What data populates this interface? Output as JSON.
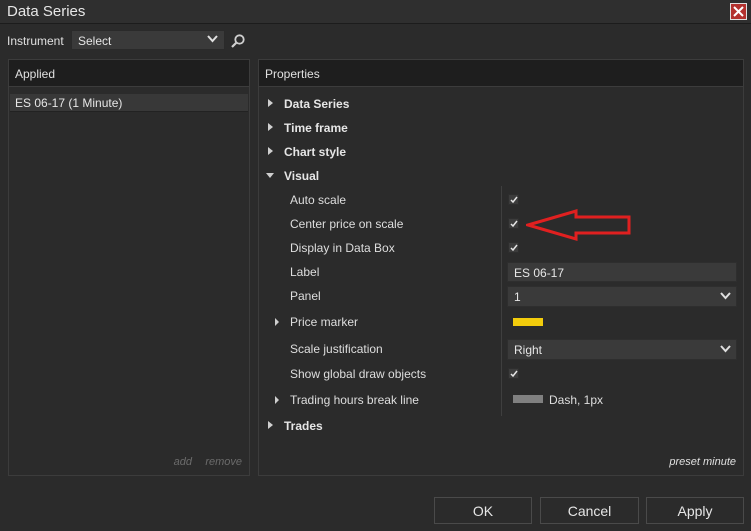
{
  "window": {
    "title": "Data Series"
  },
  "colors": {
    "accent_close": "#b3312e",
    "price_marker": "#f2cc0c",
    "break_line": "#808080",
    "annotation_arrow": "#e02020"
  },
  "instrument": {
    "label": "Instrument",
    "select_value": "Select"
  },
  "applied": {
    "header": "Applied",
    "items": [
      "ES 06-17 (1 Minute)"
    ],
    "add_label": "add",
    "remove_label": "remove"
  },
  "properties": {
    "header": "Properties",
    "groups": {
      "data_series": "Data Series",
      "time_frame": "Time frame",
      "chart_style": "Chart style",
      "visual": "Visual",
      "trades": "Trades"
    },
    "visual_rows": {
      "auto_scale": {
        "label": "Auto scale",
        "checked": true
      },
      "center_price": {
        "label": "Center price on scale",
        "checked": true
      },
      "display_data_box": {
        "label": "Display in Data Box",
        "checked": true
      },
      "label": {
        "label": "Label",
        "value": "ES 06-17"
      },
      "panel": {
        "label": "Panel",
        "value": "1"
      },
      "price_marker": {
        "label": "Price marker"
      },
      "scale_justification": {
        "label": "Scale justification",
        "value": "Right"
      },
      "global_draw": {
        "label": "Show global draw objects",
        "checked": true
      },
      "break_line": {
        "label": "Trading hours break line",
        "value": "Dash, 1px"
      }
    },
    "preset_note": "preset minute"
  },
  "buttons": {
    "ok": "OK",
    "cancel": "Cancel",
    "apply": "Apply"
  },
  "icons": {
    "close": "close-icon",
    "search": "search-icon",
    "dropdown": "chevron-down-icon",
    "expand": "triangle-right-icon",
    "collapse": "triangle-down-icon",
    "check": "check-icon"
  }
}
